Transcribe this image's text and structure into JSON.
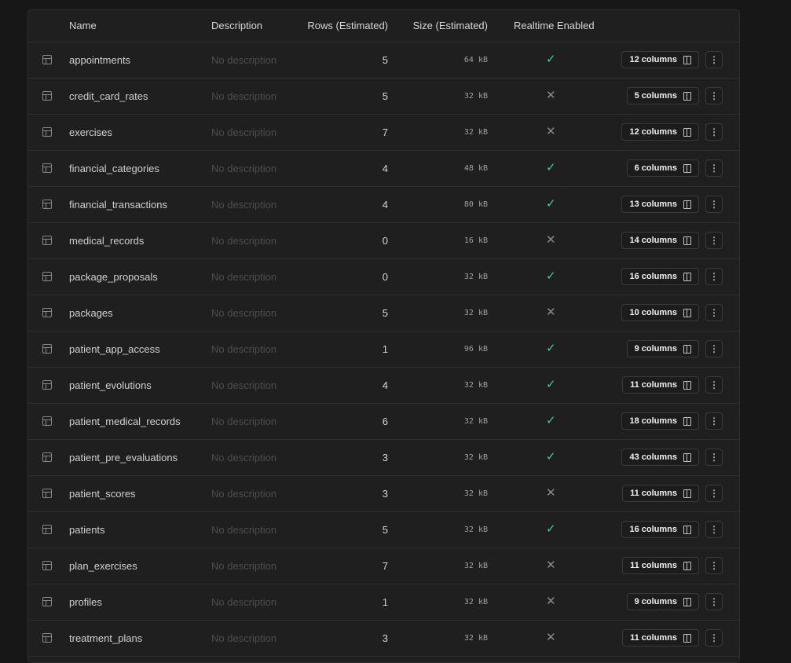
{
  "headers": {
    "name": "Name",
    "description": "Description",
    "rows": "Rows (Estimated)",
    "size": "Size (Estimated)",
    "realtime": "Realtime Enabled"
  },
  "colors": {
    "realtime_on": "#3ecf8e",
    "realtime_off": "#8a8a8a"
  },
  "tables": [
    {
      "name": "appointments",
      "description": "No description",
      "rows": "5",
      "size": "64 kB",
      "realtime": true,
      "columns": "12 columns"
    },
    {
      "name": "credit_card_rates",
      "description": "No description",
      "rows": "5",
      "size": "32 kB",
      "realtime": false,
      "columns": "5 columns"
    },
    {
      "name": "exercises",
      "description": "No description",
      "rows": "7",
      "size": "32 kB",
      "realtime": false,
      "columns": "12 columns"
    },
    {
      "name": "financial_categories",
      "description": "No description",
      "rows": "4",
      "size": "48 kB",
      "realtime": true,
      "columns": "6 columns"
    },
    {
      "name": "financial_transactions",
      "description": "No description",
      "rows": "4",
      "size": "80 kB",
      "realtime": true,
      "columns": "13 columns"
    },
    {
      "name": "medical_records",
      "description": "No description",
      "rows": "0",
      "size": "16 kB",
      "realtime": false,
      "columns": "14 columns"
    },
    {
      "name": "package_proposals",
      "description": "No description",
      "rows": "0",
      "size": "32 kB",
      "realtime": true,
      "columns": "16 columns"
    },
    {
      "name": "packages",
      "description": "No description",
      "rows": "5",
      "size": "32 kB",
      "realtime": false,
      "columns": "10 columns"
    },
    {
      "name": "patient_app_access",
      "description": "No description",
      "rows": "1",
      "size": "96 kB",
      "realtime": true,
      "columns": "9 columns"
    },
    {
      "name": "patient_evolutions",
      "description": "No description",
      "rows": "4",
      "size": "32 kB",
      "realtime": true,
      "columns": "11 columns"
    },
    {
      "name": "patient_medical_records",
      "description": "No description",
      "rows": "6",
      "size": "32 kB",
      "realtime": true,
      "columns": "18 columns"
    },
    {
      "name": "patient_pre_evaluations",
      "description": "No description",
      "rows": "3",
      "size": "32 kB",
      "realtime": true,
      "columns": "43 columns"
    },
    {
      "name": "patient_scores",
      "description": "No description",
      "rows": "3",
      "size": "32 kB",
      "realtime": false,
      "columns": "11 columns"
    },
    {
      "name": "patients",
      "description": "No description",
      "rows": "5",
      "size": "32 kB",
      "realtime": true,
      "columns": "16 columns"
    },
    {
      "name": "plan_exercises",
      "description": "No description",
      "rows": "7",
      "size": "32 kB",
      "realtime": false,
      "columns": "11 columns"
    },
    {
      "name": "profiles",
      "description": "No description",
      "rows": "1",
      "size": "32 kB",
      "realtime": false,
      "columns": "9 columns"
    },
    {
      "name": "treatment_plans",
      "description": "No description",
      "rows": "3",
      "size": "32 kB",
      "realtime": false,
      "columns": "11 columns"
    }
  ]
}
